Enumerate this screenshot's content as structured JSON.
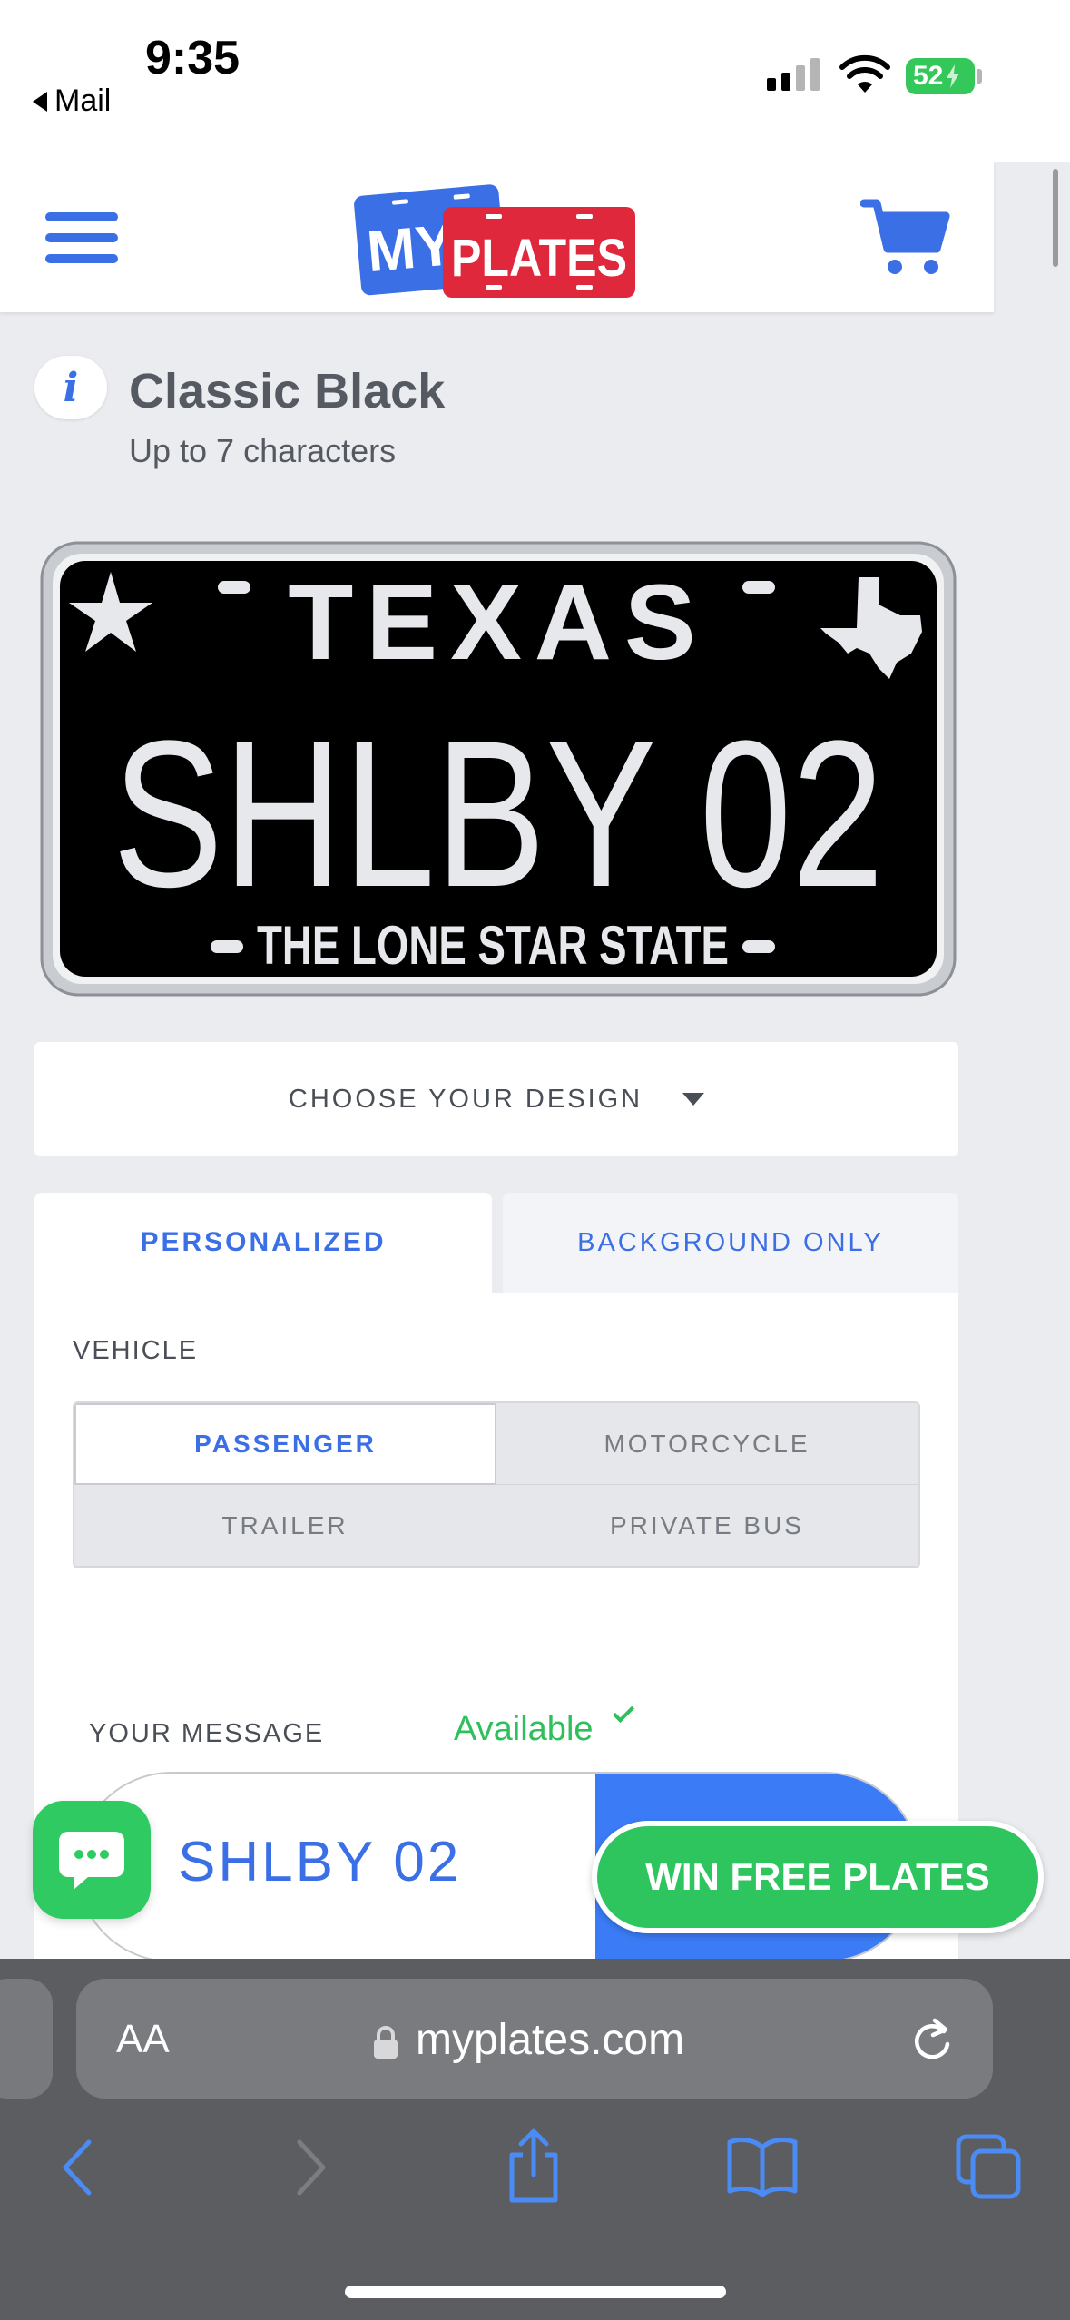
{
  "status_bar": {
    "time": "9:35",
    "back_app": "Mail",
    "battery": "52",
    "icons": [
      "signal-icon",
      "wifi-icon",
      "battery-charging-icon"
    ]
  },
  "header": {
    "logo_my": "MY",
    "logo_plates": "PLATES",
    "icons": [
      "menu-icon",
      "cart-icon"
    ],
    "brand_blue": "#3b6fe6",
    "brand_red": "#e0283c"
  },
  "design_info": {
    "icon": "i",
    "title": "Classic Black",
    "subtitle": "Up to 7 characters"
  },
  "plate": {
    "state": "TEXAS",
    "message": "SHLBY 02",
    "slogan": "THE LONE STAR STATE",
    "background": "#000000"
  },
  "design_dropdown": {
    "label": "CHOOSE YOUR DESIGN"
  },
  "tabs": {
    "personalized": "PERSONALIZED",
    "background_only": "BACKGROUND ONLY",
    "active": "PERSONALIZED"
  },
  "vehicle": {
    "label": "VEHICLE",
    "options": [
      "PASSENGER",
      "MOTORCYCLE",
      "TRAILER",
      "PRIVATE BUS"
    ],
    "selected": "PASSENGER"
  },
  "message": {
    "label": "YOUR MESSAGE",
    "status": "Available",
    "value": "SHLBY 02",
    "status_color": "#2fbf5c"
  },
  "promo": {
    "win_button": "WIN FREE PLATES",
    "chat_icon": "chat-icon"
  },
  "safari": {
    "aa": "AA",
    "url": "myplates.com",
    "icons": [
      "back-icon",
      "forward-icon",
      "share-icon",
      "bookmarks-icon",
      "tabs-icon",
      "reload-icon",
      "lock-icon"
    ]
  }
}
